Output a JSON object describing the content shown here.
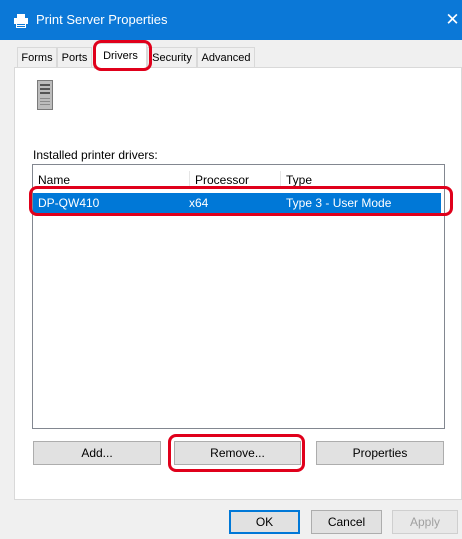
{
  "window": {
    "title": "Print Server Properties",
    "close_glyph": "✕"
  },
  "tabs": [
    {
      "label": "Forms"
    },
    {
      "label": "Ports"
    },
    {
      "label": "Drivers"
    },
    {
      "label": "Security"
    },
    {
      "label": "Advanced"
    }
  ],
  "drivers": {
    "label": "Installed printer drivers:",
    "columns": [
      "Name",
      "Processor",
      "Type"
    ],
    "rows": [
      {
        "name": "DP-QW410",
        "processor": "x64",
        "type": "Type 3 - User Mode",
        "selected": true
      }
    ]
  },
  "panel_buttons": {
    "add": "Add...",
    "remove": "Remove...",
    "properties": "Properties"
  },
  "dialog_buttons": {
    "ok": "OK",
    "cancel": "Cancel",
    "apply": "Apply"
  },
  "colors": {
    "titlebar": "#0b78d7",
    "selection": "#0078d7",
    "highlight": "#e0001b"
  },
  "icons": {
    "window": "printer-icon",
    "server": "server-icon"
  }
}
